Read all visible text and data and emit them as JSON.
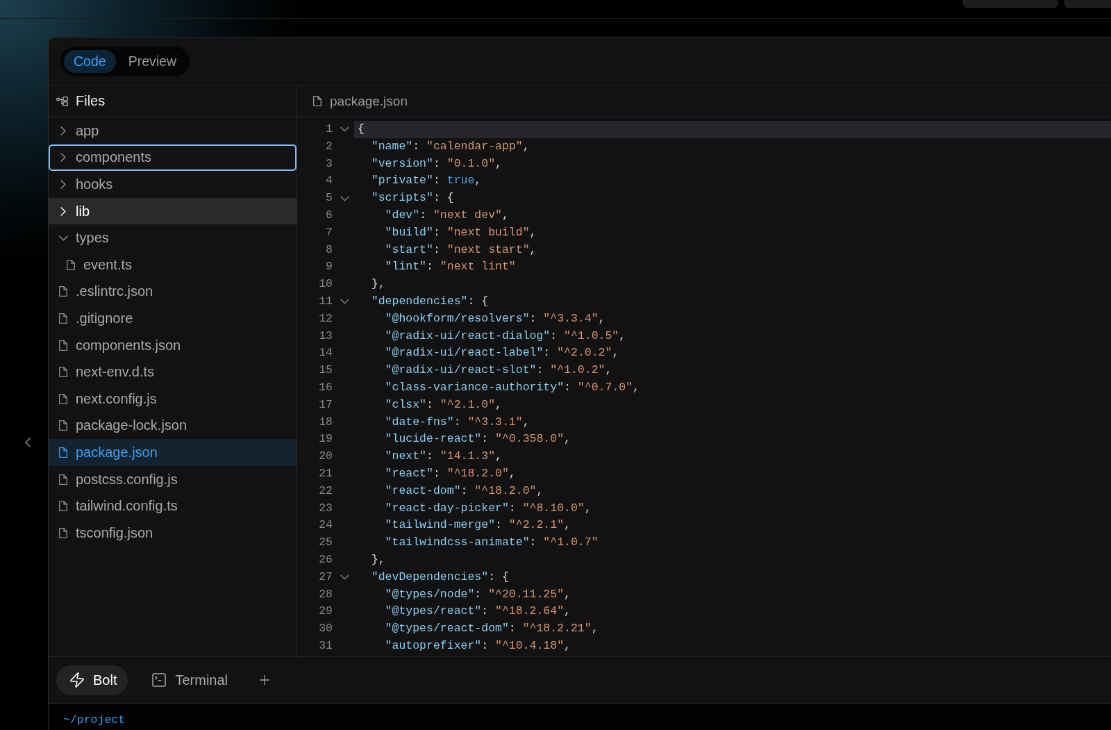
{
  "view_tabs": [
    {
      "label": "Code",
      "selected": true
    },
    {
      "label": "Preview",
      "selected": false
    }
  ],
  "sidebar": {
    "title": "Files",
    "items": [
      {
        "name": "app",
        "kind": "folder",
        "expanded": false,
        "selected": false,
        "focused": false,
        "hovered": false
      },
      {
        "name": "components",
        "kind": "folder",
        "expanded": false,
        "selected": false,
        "focused": true,
        "hovered": false
      },
      {
        "name": "hooks",
        "kind": "folder",
        "expanded": false,
        "selected": false,
        "focused": false,
        "hovered": false
      },
      {
        "name": "lib",
        "kind": "folder",
        "expanded": false,
        "selected": false,
        "focused": false,
        "hovered": true
      },
      {
        "name": "types",
        "kind": "folder",
        "expanded": true,
        "selected": false,
        "focused": false,
        "hovered": false,
        "children": [
          {
            "name": "event.ts",
            "kind": "file",
            "selected": false,
            "focused": false,
            "hovered": false
          }
        ]
      },
      {
        "name": ".eslintrc.json",
        "kind": "file",
        "selected": false,
        "focused": false,
        "hovered": false
      },
      {
        "name": ".gitignore",
        "kind": "file",
        "selected": false,
        "focused": false,
        "hovered": false
      },
      {
        "name": "components.json",
        "kind": "file",
        "selected": false,
        "focused": false,
        "hovered": false
      },
      {
        "name": "next-env.d.ts",
        "kind": "file",
        "selected": false,
        "focused": false,
        "hovered": false
      },
      {
        "name": "next.config.js",
        "kind": "file",
        "selected": false,
        "focused": false,
        "hovered": false
      },
      {
        "name": "package-lock.json",
        "kind": "file",
        "selected": false,
        "focused": false,
        "hovered": false
      },
      {
        "name": "package.json",
        "kind": "file",
        "selected": true,
        "focused": false,
        "hovered": false
      },
      {
        "name": "postcss.config.js",
        "kind": "file",
        "selected": false,
        "focused": false,
        "hovered": false
      },
      {
        "name": "tailwind.config.ts",
        "kind": "file",
        "selected": false,
        "focused": false,
        "hovered": false
      },
      {
        "name": "tsconfig.json",
        "kind": "file",
        "selected": false,
        "focused": false,
        "hovered": false
      }
    ]
  },
  "editor": {
    "tab": {
      "label": "package.json"
    },
    "lines": [
      {
        "number": "1",
        "text": "{",
        "fold": true,
        "active": true
      },
      {
        "number": "2",
        "text": "  \"name\": \"calendar-app\",",
        "fold": false,
        "active": false
      },
      {
        "number": "3",
        "text": "  \"version\": \"0.1.0\",",
        "fold": false,
        "active": false
      },
      {
        "number": "4",
        "text": "  \"private\": true,",
        "fold": false,
        "active": false
      },
      {
        "number": "5",
        "text": "  \"scripts\": {",
        "fold": true,
        "active": false
      },
      {
        "number": "6",
        "text": "    \"dev\": \"next dev\",",
        "fold": false,
        "active": false
      },
      {
        "number": "7",
        "text": "    \"build\": \"next build\",",
        "fold": false,
        "active": false
      },
      {
        "number": "8",
        "text": "    \"start\": \"next start\",",
        "fold": false,
        "active": false
      },
      {
        "number": "9",
        "text": "    \"lint\": \"next lint\"",
        "fold": false,
        "active": false
      },
      {
        "number": "10",
        "text": "  },",
        "fold": false,
        "active": false
      },
      {
        "number": "11",
        "text": "  \"dependencies\": {",
        "fold": true,
        "active": false
      },
      {
        "number": "12",
        "text": "    \"@hookform/resolvers\": \"^3.3.4\",",
        "fold": false,
        "active": false
      },
      {
        "number": "13",
        "text": "    \"@radix-ui/react-dialog\": \"^1.0.5\",",
        "fold": false,
        "active": false
      },
      {
        "number": "14",
        "text": "    \"@radix-ui/react-label\": \"^2.0.2\",",
        "fold": false,
        "active": false
      },
      {
        "number": "15",
        "text": "    \"@radix-ui/react-slot\": \"^1.0.2\",",
        "fold": false,
        "active": false
      },
      {
        "number": "16",
        "text": "    \"class-variance-authority\": \"^0.7.0\",",
        "fold": false,
        "active": false
      },
      {
        "number": "17",
        "text": "    \"clsx\": \"^2.1.0\",",
        "fold": false,
        "active": false
      },
      {
        "number": "18",
        "text": "    \"date-fns\": \"^3.3.1\",",
        "fold": false,
        "active": false
      },
      {
        "number": "19",
        "text": "    \"lucide-react\": \"^0.358.0\",",
        "fold": false,
        "active": false
      },
      {
        "number": "20",
        "text": "    \"next\": \"14.1.3\",",
        "fold": false,
        "active": false
      },
      {
        "number": "21",
        "text": "    \"react\": \"^18.2.0\",",
        "fold": false,
        "active": false
      },
      {
        "number": "22",
        "text": "    \"react-dom\": \"^18.2.0\",",
        "fold": false,
        "active": false
      },
      {
        "number": "23",
        "text": "    \"react-day-picker\": \"^8.10.0\",",
        "fold": false,
        "active": false
      },
      {
        "number": "24",
        "text": "    \"tailwind-merge\": \"^2.2.1\",",
        "fold": false,
        "active": false
      },
      {
        "number": "25",
        "text": "    \"tailwindcss-animate\": \"^1.0.7\"",
        "fold": false,
        "active": false
      },
      {
        "number": "26",
        "text": "  },",
        "fold": false,
        "active": false
      },
      {
        "number": "27",
        "text": "  \"devDependencies\": {",
        "fold": true,
        "active": false
      },
      {
        "number": "28",
        "text": "    \"@types/node\": \"^20.11.25\",",
        "fold": false,
        "active": false
      },
      {
        "number": "29",
        "text": "    \"@types/react\": \"^18.2.64\",",
        "fold": false,
        "active": false
      },
      {
        "number": "30",
        "text": "    \"@types/react-dom\": \"^18.2.21\",",
        "fold": false,
        "active": false
      },
      {
        "number": "31",
        "text": "    \"autoprefixer\": \"^10.4.18\",",
        "fold": false,
        "active": false
      }
    ]
  },
  "bottom_tabs": [
    {
      "label": "Bolt",
      "kind": "bolt",
      "selected": true
    },
    {
      "label": "Terminal",
      "kind": "terminal",
      "selected": false
    }
  ],
  "terminal": {
    "prompt": "~/project"
  }
}
